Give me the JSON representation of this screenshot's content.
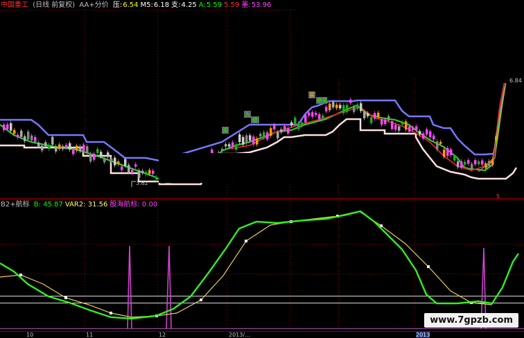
{
  "header": {
    "stock_name": "中国重工",
    "period": "(日线 前复权)",
    "indicator": "AA+分价",
    "items": [
      {
        "label": "压:",
        "value": "6.54",
        "label_color": "#ffffff",
        "value_color": "#ffff00"
      },
      {
        "label": "M5:",
        "value": "6.18",
        "label_color": "#ffffff",
        "value_color": "#ffffff"
      },
      {
        "label": "支:",
        "value": "4.25",
        "label_color": "#ffffff",
        "value_color": "#ffffff"
      },
      {
        "label": "A:",
        "value": "5.59",
        "label_color": "#00ff00",
        "value_color": "#00ff00"
      },
      {
        "label": "",
        "value": "5.59",
        "label_color": "#ff3030",
        "value_color": "#ff3030"
      },
      {
        "label": "墨:",
        "value": "53.96",
        "label_color": "#ff44ff",
        "value_color": "#ff44ff"
      }
    ]
  },
  "sub_header": {
    "indicator": "B2+航标",
    "items": [
      {
        "label": "B:",
        "value": "45.87",
        "color": "#00ff00"
      },
      {
        "label": "VAR2:",
        "value": "31.56",
        "color": "#ffff66"
      },
      {
        "label": "股海航标:",
        "value": "0.00",
        "color": "#ff44ff"
      }
    ]
  },
  "price_labels": [
    {
      "text": "6.84",
      "color": "#c0c0c0"
    },
    {
      "text": "3.82",
      "color": "#c0c0c0"
    },
    {
      "text": "5",
      "color": "#ff3030"
    }
  ],
  "chart_badges": [
    "买",
    "入",
    "绝",
    "买",
    "绝买"
  ],
  "x_axis_labels": [
    "10",
    "11",
    "12",
    "2013/...",
    "2013"
  ],
  "watermark": "www.7gpzb.com",
  "colors": {
    "resistance_line": "#7777ff",
    "support_line": "#ffe0e0",
    "ma_green": "#22dd22",
    "ma_red": "#dd2222",
    "b_line": "#33ee22",
    "var2_line": "#e6d060",
    "navigator_spike": "#cc44cc",
    "grid": "#8b0000"
  }
}
